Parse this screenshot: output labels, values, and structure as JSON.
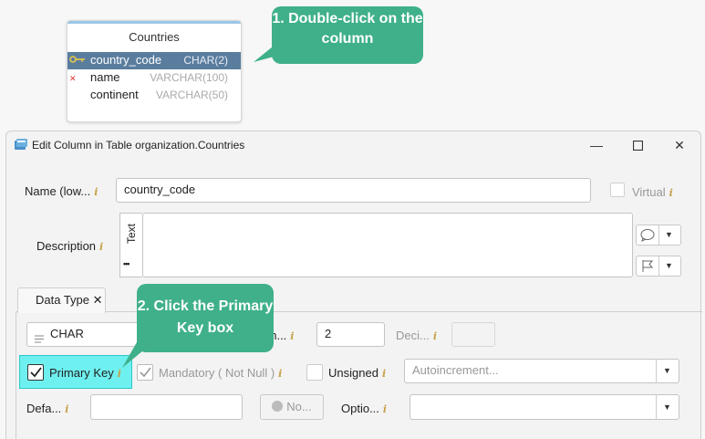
{
  "diagram_table": {
    "title": "Countries",
    "rows": [
      {
        "name": "country_code",
        "type": "CHAR(2)"
      },
      {
        "name": "name",
        "type": "VARCHAR(100)"
      },
      {
        "name": "continent",
        "type": "VARCHAR(50)"
      }
    ]
  },
  "callouts": {
    "step1": "1. Double-click on the column",
    "step2": "2. Click the Primary Key box"
  },
  "dialog": {
    "title": "Edit Column in Table organization.Countries",
    "name_label": "Name (low...",
    "name_value": "country_code",
    "virtual_label": "Virtual",
    "description_label": "Description",
    "text_toggle": "Text",
    "more": "•••",
    "tab_label": "Data Type",
    "tab_close": "✕",
    "type_value": "CHAR",
    "length_label_partial": "en...",
    "length_value": "2",
    "decimal_label": "Deci...",
    "primary_key_label": "Primary Key",
    "mandatory_label": "Mandatory ( Not Null )",
    "unsigned_label": "Unsigned",
    "autoincrement_placeholder": "Autoincrement...",
    "default_label": "Defa...",
    "no_button": "No...",
    "options_label": "Optio..."
  },
  "colors": {
    "callout": "#3fb08a",
    "highlight": "#6ff0f0",
    "selected_row": "#5a7d9e"
  }
}
